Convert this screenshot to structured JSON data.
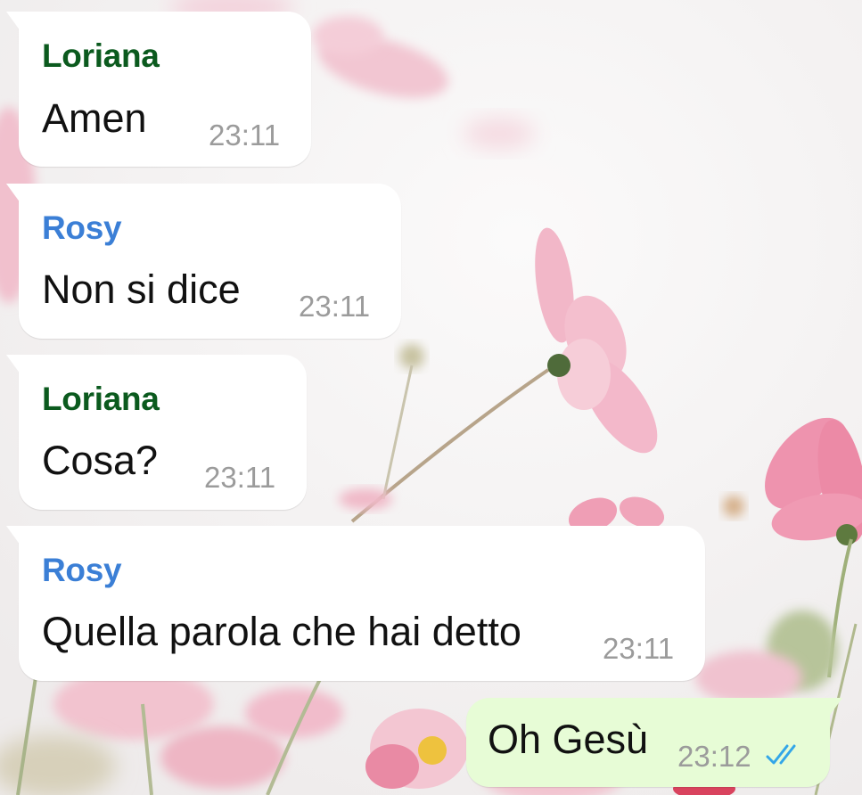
{
  "colors": {
    "sender_loriana": "#0b5a1e",
    "sender_rosy": "#3b7fd6",
    "incoming_bubble": "#ffffff",
    "outgoing_bubble": "#e7fcd6",
    "timestamp": "#9b9b9b",
    "read_ticks": "#33a6e8"
  },
  "messages": [
    {
      "direction": "incoming",
      "sender": "Loriana",
      "text": "Amen",
      "time": "23:11"
    },
    {
      "direction": "incoming",
      "sender": "Rosy",
      "text": "Non si dice",
      "time": "23:11"
    },
    {
      "direction": "incoming",
      "sender": "Loriana",
      "text": "Cosa?",
      "time": "23:11"
    },
    {
      "direction": "incoming",
      "sender": "Rosy",
      "text": "Quella parola che hai detto",
      "time": "23:11"
    },
    {
      "direction": "outgoing",
      "text": "Oh Gesù",
      "time": "23:12",
      "status_icon": "double-check-read-icon"
    }
  ]
}
